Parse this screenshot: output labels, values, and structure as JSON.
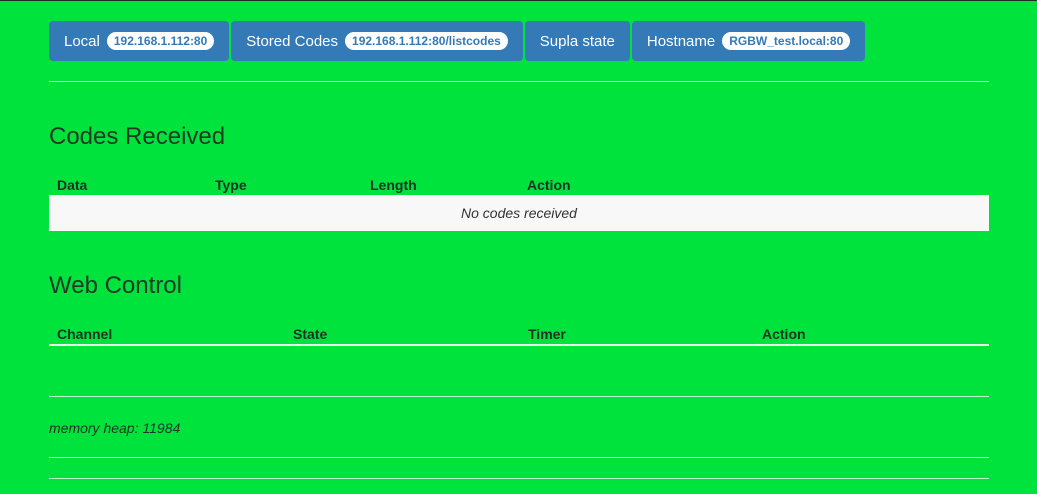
{
  "nav": {
    "local_label": "Local",
    "local_value": "192.168.1.112:80",
    "stored_label": "Stored Codes",
    "stored_value": "192.168.1.112:80/listcodes",
    "supla_label": "Supla state",
    "hostname_label": "Hostname",
    "hostname_value": "RGBW_test.local:80"
  },
  "codes": {
    "title": "Codes Received",
    "columns": [
      "Data",
      "Type",
      "Length",
      "Action"
    ],
    "empty_text": "No codes received"
  },
  "web_control": {
    "title": "Web Control",
    "columns": [
      "Channel",
      "State",
      "Timer",
      "Action"
    ]
  },
  "footer": {
    "memory_heap": "memory heap: 11984"
  },
  "colors": {
    "background": "#00e23c",
    "button": "#337ab7",
    "badge_bg": "#ffffff"
  }
}
